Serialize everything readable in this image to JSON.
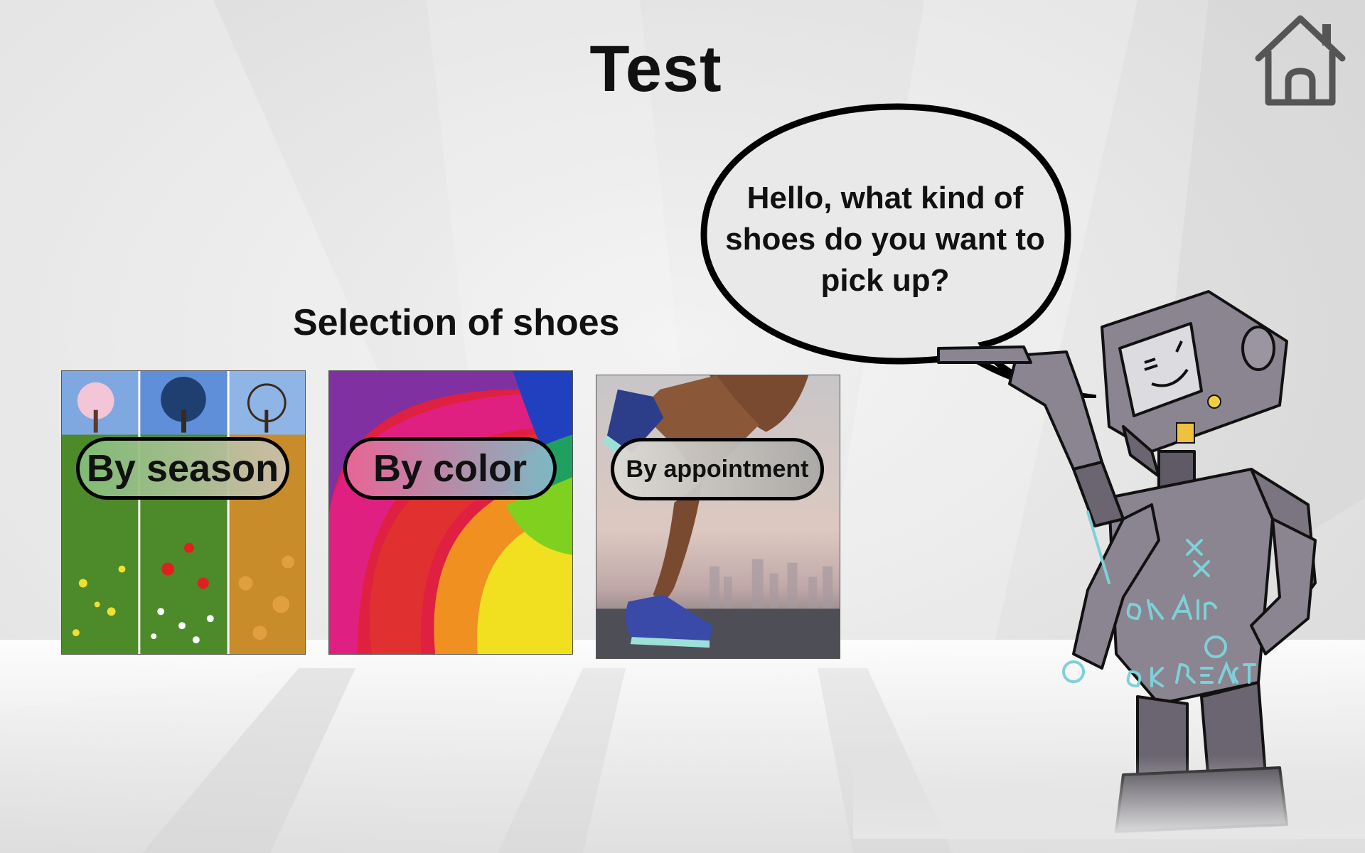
{
  "header": {
    "title": "Test",
    "home_icon": "home-icon"
  },
  "section": {
    "title": "Selection of shoes"
  },
  "cards": [
    {
      "label": "By season",
      "image": "four-seasons-image"
    },
    {
      "label": "By color",
      "image": "rainbow-swirl-image"
    },
    {
      "label": "By appointment",
      "image": "running-shoes-image"
    }
  ],
  "assistant": {
    "message": "Hello, what kind of shoes do you want to pick up?",
    "mascot": "robot-mascot"
  },
  "colors": {
    "text": "#111111",
    "background": "#e6e6e6"
  }
}
